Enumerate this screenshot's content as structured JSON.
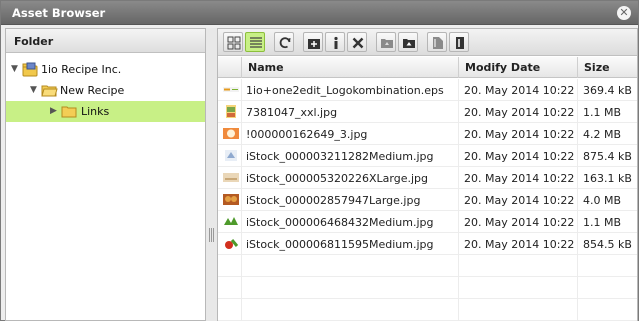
{
  "window": {
    "title": "Asset Browser",
    "close_icon": "close-icon"
  },
  "folder_panel": {
    "header": "Folder",
    "tree": [
      {
        "label": "1io Recipe Inc.",
        "icon": "server-folder-icon",
        "expanded": true
      },
      {
        "label": "New Recipe",
        "icon": "folder-open-icon",
        "expanded": true
      },
      {
        "label": "Links",
        "icon": "folder-icon",
        "expanded": false,
        "selected": true
      }
    ]
  },
  "toolbar": {
    "buttons": [
      {
        "name": "thumbnail-view-button",
        "icon": "grid-view-icon"
      },
      {
        "name": "list-view-button",
        "icon": "list-view-icon",
        "active": true
      },
      {
        "name": "refresh-button",
        "icon": "refresh-icon"
      },
      {
        "name": "new-folder-button",
        "icon": "new-folder-icon"
      },
      {
        "name": "info-button",
        "icon": "info-icon"
      },
      {
        "name": "delete-button",
        "icon": "delete-icon"
      },
      {
        "name": "folder-up-button",
        "icon": "folder-up-icon"
      },
      {
        "name": "upload-button",
        "icon": "upload-icon"
      },
      {
        "name": "place-button",
        "icon": "place-icon"
      },
      {
        "name": "edit-button",
        "icon": "edit-icon"
      }
    ]
  },
  "file_table": {
    "columns": [
      "Name",
      "Modify Date",
      "Size"
    ],
    "rows": [
      {
        "name": "1io+one2edit_Logokombination.eps",
        "date": "20. May 2014 10:22",
        "size": "369.4 kB",
        "thumb": "logo"
      },
      {
        "name": "7381047_xxl.jpg",
        "date": "20. May 2014 10:22",
        "size": "1.1 MB",
        "thumb": "food"
      },
      {
        "name": "!000000162649_3.jpg",
        "date": "20. May 2014 10:22",
        "size": "4.2 MB",
        "thumb": "orange"
      },
      {
        "name": "iStock_000003211282Medium.jpg",
        "date": "20. May 2014 10:22",
        "size": "875.4 kB",
        "thumb": "blue"
      },
      {
        "name": "iStock_000005320226XLarge.jpg",
        "date": "20. May 2014 10:22",
        "size": "163.1 kB",
        "thumb": "beige"
      },
      {
        "name": "iStock_000002857947Large.jpg",
        "date": "20. May 2014 10:22",
        "size": "4.0 MB",
        "thumb": "pastry"
      },
      {
        "name": "iStock_000006468432Medium.jpg",
        "date": "20. May 2014 10:22",
        "size": "1.1 MB",
        "thumb": "green"
      },
      {
        "name": "iStock_000006811595Medium.jpg",
        "date": "20. May 2014 10:22",
        "size": "854.5 kB",
        "thumb": "red"
      }
    ]
  },
  "colors": {
    "selected": "#c8f086",
    "titlebar": "#777777"
  }
}
